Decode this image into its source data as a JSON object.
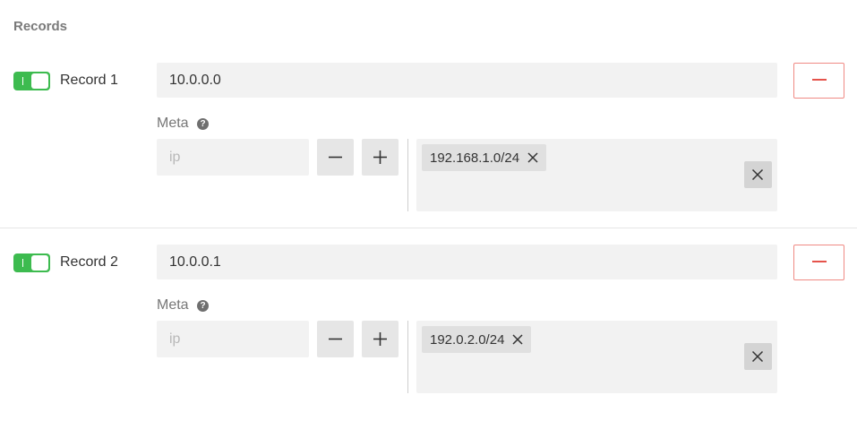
{
  "section": {
    "title": "Records"
  },
  "records": [
    {
      "enabled": true,
      "label": "Record 1",
      "address": "10.0.0.0",
      "meta_label": "Meta",
      "ip_placeholder": "ip",
      "tags": [
        "192.168.1.0/24"
      ]
    },
    {
      "enabled": true,
      "label": "Record 2",
      "address": "10.0.0.1",
      "meta_label": "Meta",
      "ip_placeholder": "ip",
      "tags": [
        "192.0.2.0/24"
      ]
    }
  ],
  "icons": {
    "toggle": "switch-on-icon",
    "remove": "minus-icon",
    "help": "question-circle-icon",
    "decrement": "minus-icon",
    "increment": "plus-icon",
    "tag_remove": "close-icon",
    "clear": "close-icon"
  },
  "colors": {
    "toggle_on": "#3dbb4f",
    "danger": "#e5534b",
    "field_bg": "#f2f2f2"
  }
}
